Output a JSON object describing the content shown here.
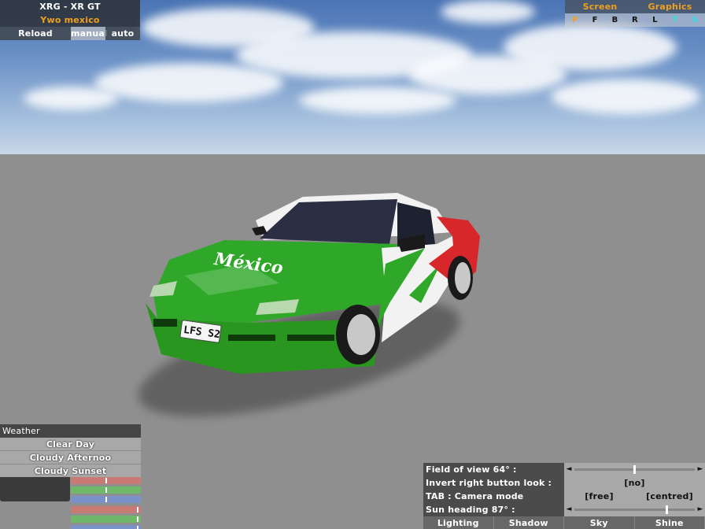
{
  "car_panel": {
    "car_name": "XRG - XR GT",
    "skin_name": "Ywo mexico",
    "buttons": [
      "Reload",
      "manual",
      "auto"
    ]
  },
  "view_panel": {
    "tabs": [
      "Screen",
      "Graphics"
    ],
    "views": [
      "P",
      "F",
      "B",
      "R",
      "L",
      "T",
      "S"
    ]
  },
  "car": {
    "livery_text": "México",
    "plate": "LFS S2",
    "colors": {
      "green": "#2fa82a",
      "white": "#f2f2f2",
      "red": "#d8272a"
    }
  },
  "weather": {
    "title": "Weather",
    "options": [
      "Clear Day",
      "Cloudy Afternoo",
      "Cloudy Sunset"
    ],
    "swatch_color": "#3a3a3a",
    "sliders": [
      {
        "color": "#c87a74",
        "value": 0.5
      },
      {
        "color": "#6fb86a",
        "value": 0.5
      },
      {
        "color": "#7a92c8",
        "value": 0.5
      },
      {
        "color": "#c87a74",
        "value": 0.97
      },
      {
        "color": "#6fb86a",
        "value": 0.97
      },
      {
        "color": "#7a92c8",
        "value": 0.97
      }
    ]
  },
  "camera": {
    "fov_label": "Field of view 64° :",
    "fov_value": 0.5,
    "invert_label": "Invert right button look :",
    "invert_value": "[no]",
    "tab_label": "TAB : Camera mode",
    "mode_free": "[free]",
    "mode_centred": "[centred]",
    "sun_label": "Sun heading 87° :",
    "sun_value": 0.77,
    "arrow_left": "◄",
    "arrow_right": "►",
    "tabs": [
      "Lighting",
      "Shadow",
      "Sky",
      "Shine"
    ]
  }
}
